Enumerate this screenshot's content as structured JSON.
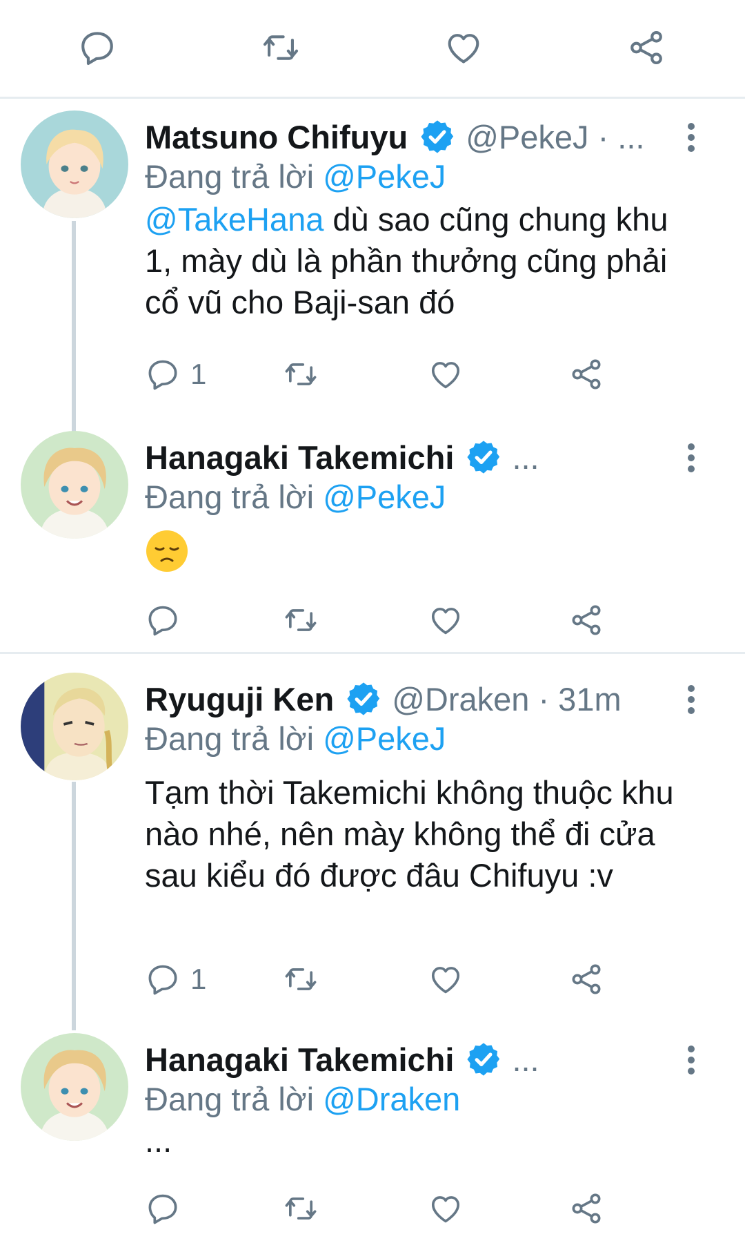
{
  "top_bar": {
    "icons": [
      "reply-icon",
      "retweet-icon",
      "like-icon",
      "share-icon"
    ]
  },
  "tweets": [
    {
      "display_name": "Matsuno Chifuyu",
      "handle_meta": "@PekeJ · ...",
      "replying_prefix": "Đang trả lời",
      "replying_to": "@PekeJ",
      "body_mention": "@TakeHana",
      "body_text": " dù sao cũng chung khu 1, mày dù là phần thưởng cũng phải cổ vũ cho Baji-san đó",
      "reply_count": "1",
      "avatar": "blond-boy-avatar"
    },
    {
      "display_name": "Hanagaki Takemichi",
      "handle_meta": "...",
      "replying_prefix": "Đang trả lời",
      "replying_to": "@PekeJ",
      "body_emoji": "disappointed-face-emoji",
      "reply_count": "",
      "avatar": "curly-blond-boy-avatar"
    },
    {
      "display_name": "Ryuguji Ken",
      "handle_meta": "@Draken · 31m",
      "replying_prefix": "Đang trả lời",
      "replying_to": "@PekeJ",
      "body_text": "Tạm thời Takemichi không thuộc khu nào nhé, nên mày không thể đi cửa sau kiểu đó được đâu Chifuyu :v",
      "reply_count": "1",
      "avatar": "braided-man-avatar"
    },
    {
      "display_name": "Hanagaki Takemichi",
      "handle_meta": "...",
      "replying_prefix": "Đang trả lời",
      "replying_to": "@Draken",
      "body_text": "...",
      "reply_count": "",
      "avatar": "curly-blond-boy-avatar"
    }
  ],
  "colors": {
    "accent": "#1da1f2",
    "secondary_text": "#657786",
    "primary_text": "#14171a",
    "divider": "#e6ecf0",
    "thread_line": "#ccd6dd"
  }
}
